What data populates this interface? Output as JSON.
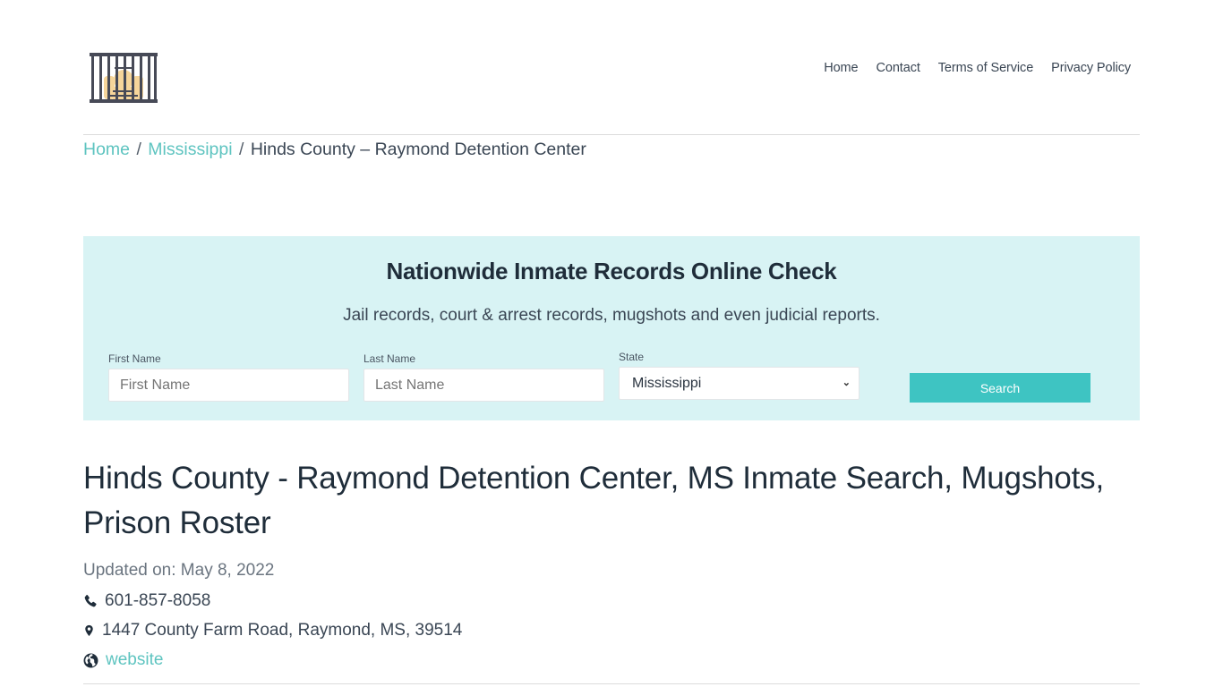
{
  "header": {
    "logo_alt": "jail-cell-logo",
    "nav": [
      {
        "label": "Home"
      },
      {
        "label": "Contact"
      },
      {
        "label": "Terms of Service"
      },
      {
        "label": "Privacy Policy"
      }
    ]
  },
  "breadcrumb": {
    "items": [
      {
        "label": "Home",
        "link": true
      },
      {
        "label": "Mississippi",
        "link": true
      },
      {
        "label": "Hinds County – Raymond Detention Center",
        "link": false
      }
    ],
    "separator": "/"
  },
  "search": {
    "title": "Nationwide Inmate Records Online Check",
    "subtitle": "Jail records, court & arrest records, mugshots and even judicial reports.",
    "first_name": {
      "label": "First Name",
      "placeholder": "First Name",
      "value": ""
    },
    "last_name": {
      "label": "Last Name",
      "placeholder": "Last Name",
      "value": ""
    },
    "state": {
      "label": "State",
      "selected": "Mississippi"
    },
    "button_label": "Search"
  },
  "page": {
    "title": "Hinds County - Raymond Detention Center, MS Inmate Search, Mugshots, Prison Roster",
    "updated": "Updated on: May 8, 2022",
    "phone": "601-857-8058",
    "address": "1447 County Farm Road, Raymond, MS, 39514",
    "website_label": "website"
  },
  "colors": {
    "accent": "#3ec4c2",
    "link": "#5ec4c0",
    "panel_bg": "#d8f3f4",
    "text_dark": "#1f2d3a"
  }
}
